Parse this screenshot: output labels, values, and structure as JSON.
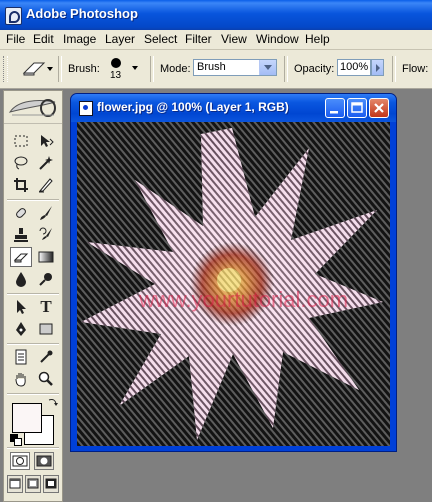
{
  "app": {
    "title": "Adobe Photoshop"
  },
  "menu": [
    "File",
    "Edit",
    "Image",
    "Layer",
    "Select",
    "Filter",
    "View",
    "Window",
    "Help"
  ],
  "options": {
    "brush_label": "Brush:",
    "brush_size": "13",
    "mode_label": "Mode:",
    "mode_value": "Brush",
    "opacity_label": "Opacity:",
    "opacity_value": "100%",
    "flow_label": "Flow:"
  },
  "document": {
    "title": "flower.jpg @ 100% (Layer 1, RGB)",
    "watermark": "www.yourtutorial.com",
    "watermark_color": "#e0204a"
  },
  "colors": {
    "foreground": "#fbf6f6",
    "background": "#ffffff"
  }
}
